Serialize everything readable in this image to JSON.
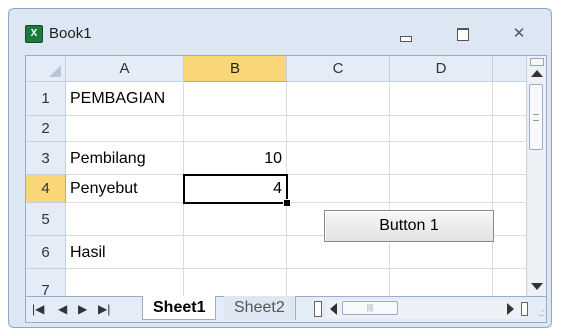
{
  "window": {
    "title": "Book1",
    "icon": "excel-workbook-icon",
    "controls": {
      "minimize": "minimize-icon",
      "restore": "restore-icon",
      "close": "✕"
    }
  },
  "grid": {
    "columns": [
      "A",
      "B",
      "C",
      "D"
    ],
    "active_column": "B",
    "rows": [
      "1",
      "2",
      "3",
      "4",
      "5",
      "6",
      "7"
    ],
    "active_row": "4",
    "cells": {
      "A1": "PEMBAGIAN",
      "A3": "Pembilang",
      "B3": "10",
      "A4": "Penyebut",
      "B4": "4",
      "A6": "Hasil"
    },
    "selected_cell": "B4"
  },
  "form_button": {
    "label": "Button 1"
  },
  "tabs": {
    "nav": [
      "|◀",
      "◀",
      "▶",
      "▶|"
    ],
    "sheets": [
      {
        "label": "Sheet1",
        "active": true
      },
      {
        "label": "Sheet2",
        "active": false
      }
    ]
  },
  "colors": {
    "header_bg": "#e4ecf7",
    "active_header_bg": "#f9d677",
    "grid_line": "#dadcdd"
  }
}
